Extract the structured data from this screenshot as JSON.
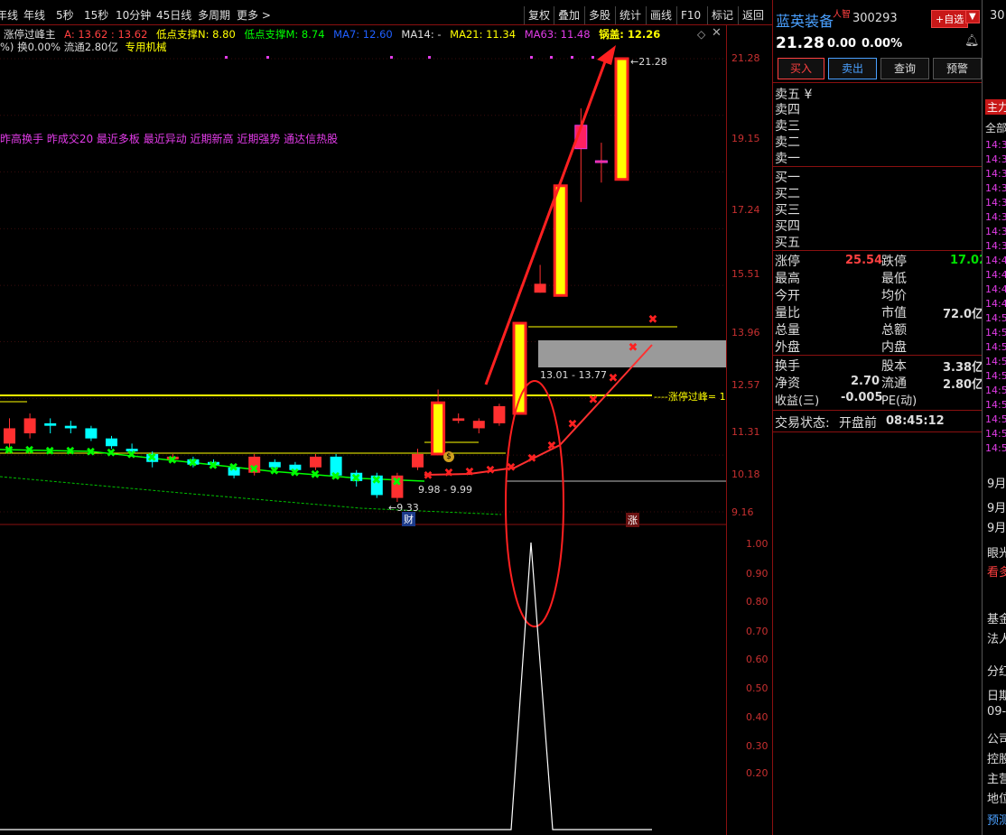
{
  "toolbar": {
    "periods": [
      "年线",
      "年线",
      "5秒",
      "15秒",
      "10分钟",
      "45日线",
      "多周期",
      "更多 >"
    ],
    "right_buttons": [
      "复权",
      "叠加",
      "多股",
      "统计",
      "画线",
      "F10",
      "标记",
      "返回"
    ]
  },
  "indicator_line": {
    "title": "涨停过峰主",
    "a": "A: 13.62 : 13.62",
    "n": "低点支撑N: 8.80",
    "m": "低点支撑M: 8.74",
    "ma7": "MA7: 12.60",
    "ma14": "MA14: -",
    "ma21": "MA21: 11.34",
    "ma63": "MA63: 11.48",
    "guogai": "锅盖: 12.26"
  },
  "info_line": {
    "turnover": "%) 换0.00% 流通2.80亿",
    "industry": "专用机械"
  },
  "tags_line": "昨高换手 昨成交20 最近多板 最近异动 近期新高 近期强势 通达信热股",
  "price_axis": [
    "21.28",
    "19.15",
    "17.24",
    "15.51",
    "13.96",
    "12.57",
    "11.31",
    "10.18",
    "9.16"
  ],
  "indicator_axis": [
    "1.00",
    "0.90",
    "0.80",
    "0.70",
    "0.60",
    "0.50",
    "0.40",
    "0.30",
    "0.20"
  ],
  "annotations": {
    "high": "21.28",
    "low": "9.33",
    "range1": "13.01 - 13.77",
    "range2": "9.98 - 9.99",
    "peak_label": "涨停过峰= 1",
    "cai": "财",
    "zhang": "涨",
    "dollar": "$"
  },
  "chart_data": {
    "type": "candlestick",
    "candles": [
      {
        "o": 10.4,
        "c": 10.7,
        "h": 10.9,
        "l": 10.3
      },
      {
        "o": 10.6,
        "c": 10.9,
        "h": 11.0,
        "l": 10.5
      },
      {
        "o": 10.8,
        "c": 10.75,
        "h": 10.9,
        "l": 10.6
      },
      {
        "o": 10.75,
        "c": 10.7,
        "h": 10.85,
        "l": 10.6
      },
      {
        "o": 10.7,
        "c": 10.5,
        "h": 10.75,
        "l": 10.45
      },
      {
        "o": 10.5,
        "c": 10.35,
        "h": 10.55,
        "l": 10.3
      },
      {
        "o": 10.3,
        "c": 10.25,
        "h": 10.4,
        "l": 10.2
      },
      {
        "o": 10.2,
        "c": 10.05,
        "h": 10.25,
        "l": 9.95
      },
      {
        "o": 10.1,
        "c": 10.15,
        "h": 10.2,
        "l": 10.05
      },
      {
        "o": 10.1,
        "c": 10.0,
        "h": 10.15,
        "l": 9.95
      },
      {
        "o": 10.05,
        "c": 10.0,
        "h": 10.1,
        "l": 9.95
      },
      {
        "o": 9.95,
        "c": 9.8,
        "h": 10.0,
        "l": 9.75
      },
      {
        "o": 9.85,
        "c": 10.15,
        "h": 10.2,
        "l": 9.8
      },
      {
        "o": 10.05,
        "c": 9.95,
        "h": 10.1,
        "l": 9.9
      },
      {
        "o": 10.0,
        "c": 9.9,
        "h": 10.05,
        "l": 9.85
      },
      {
        "o": 9.95,
        "c": 10.15,
        "h": 10.2,
        "l": 9.9
      },
      {
        "o": 10.15,
        "c": 9.8,
        "h": 10.2,
        "l": 9.75
      },
      {
        "o": 9.85,
        "c": 9.7,
        "h": 9.9,
        "l": 9.6
      },
      {
        "o": 9.8,
        "c": 9.45,
        "h": 9.85,
        "l": 9.4
      },
      {
        "o": 9.4,
        "c": 9.8,
        "h": 9.85,
        "l": 9.33
      },
      {
        "o": 9.95,
        "c": 10.2,
        "h": 10.3,
        "l": 9.9
      },
      {
        "o": 10.2,
        "c": 11.22,
        "h": 11.5,
        "l": 10.2
      },
      {
        "o": 10.85,
        "c": 10.9,
        "h": 11.0,
        "l": 10.8
      },
      {
        "o": 10.7,
        "c": 10.85,
        "h": 10.9,
        "l": 10.6
      },
      {
        "o": 10.8,
        "c": 11.15,
        "h": 11.2,
        "l": 10.75
      },
      {
        "o": 11.0,
        "c": 13.01,
        "h": 13.01,
        "l": 11.0
      },
      {
        "o": 13.77,
        "c": 14.0,
        "h": 14.5,
        "l": 13.77
      },
      {
        "o": 13.7,
        "c": 16.8,
        "h": 16.8,
        "l": 13.7
      },
      {
        "o": 18.0,
        "c": 18.8,
        "h": 19.4,
        "l": 16.3
      },
      {
        "o": 17.6,
        "c": 17.6,
        "h": 18.2,
        "l": 16.9
      },
      {
        "o": 17.0,
        "c": 21.28,
        "h": 21.28,
        "l": 17.0
      }
    ]
  },
  "quote": {
    "name": "蓝英装备",
    "badge": "人智",
    "code": "300293",
    "add_fav": "+自选",
    "price": "21.28",
    "change": "0.00",
    "pct": "0.00%",
    "buy": "买入",
    "sell": "卖出",
    "query": "查询",
    "alert": "预警",
    "asks": [
      "卖五 ¥",
      "卖四",
      "卖三",
      "卖二",
      "卖一"
    ],
    "bids": [
      "买一",
      "买二",
      "买三",
      "买四",
      "买五"
    ],
    "limit_up_label": "涨停",
    "limit_up": "25.54",
    "limit_down_label": "跌停",
    "limit_down": "17.02",
    "high_label": "最高",
    "low_label": "最低",
    "open_label": "今开",
    "avg_label": "均价",
    "vol_ratio_label": "量比",
    "mcap_label": "市值",
    "mcap": "72.0亿",
    "total_vol_label": "总量",
    "total_amt_label": "总额",
    "outer_label": "外盘",
    "inner_label": "内盘",
    "turnover_label": "换手",
    "shares_label": "股本",
    "shares": "3.38亿",
    "nav_label": "净资",
    "nav": "2.70",
    "float_label": "流通",
    "float": "2.80亿",
    "eps_label": "收益(三)",
    "eps": "-0.005",
    "pe_label": "PE(动)",
    "status_label": "交易状态:",
    "status": "开盘前",
    "status_time": "08:45:12"
  },
  "far_panel": {
    "top": "30",
    "tab": "主力",
    "all": "全部",
    "times": [
      "14:3",
      "14:3",
      "14:3",
      "14:3",
      "14:3",
      "14:3",
      "14:3",
      "14:3",
      "14:4",
      "14:4",
      "14:4",
      "14:4",
      "14:5",
      "14:5",
      "14:5",
      "14:5",
      "14:5",
      "14:5",
      "14:5",
      "14:5",
      "14:5",
      "14:5"
    ],
    "lower": [
      "9月",
      "9月",
      "9月",
      "眼光",
      "看多",
      "基金",
      "法人",
      "分红",
      "日期",
      "09-",
      "公司",
      "控股",
      "主营",
      "地位",
      "预测"
    ]
  },
  "colors": {
    "up": "#ff3030",
    "down": "#00ffff",
    "yellow": "#ffff00",
    "magenta": "#e23ce8",
    "green": "#00ff00"
  }
}
